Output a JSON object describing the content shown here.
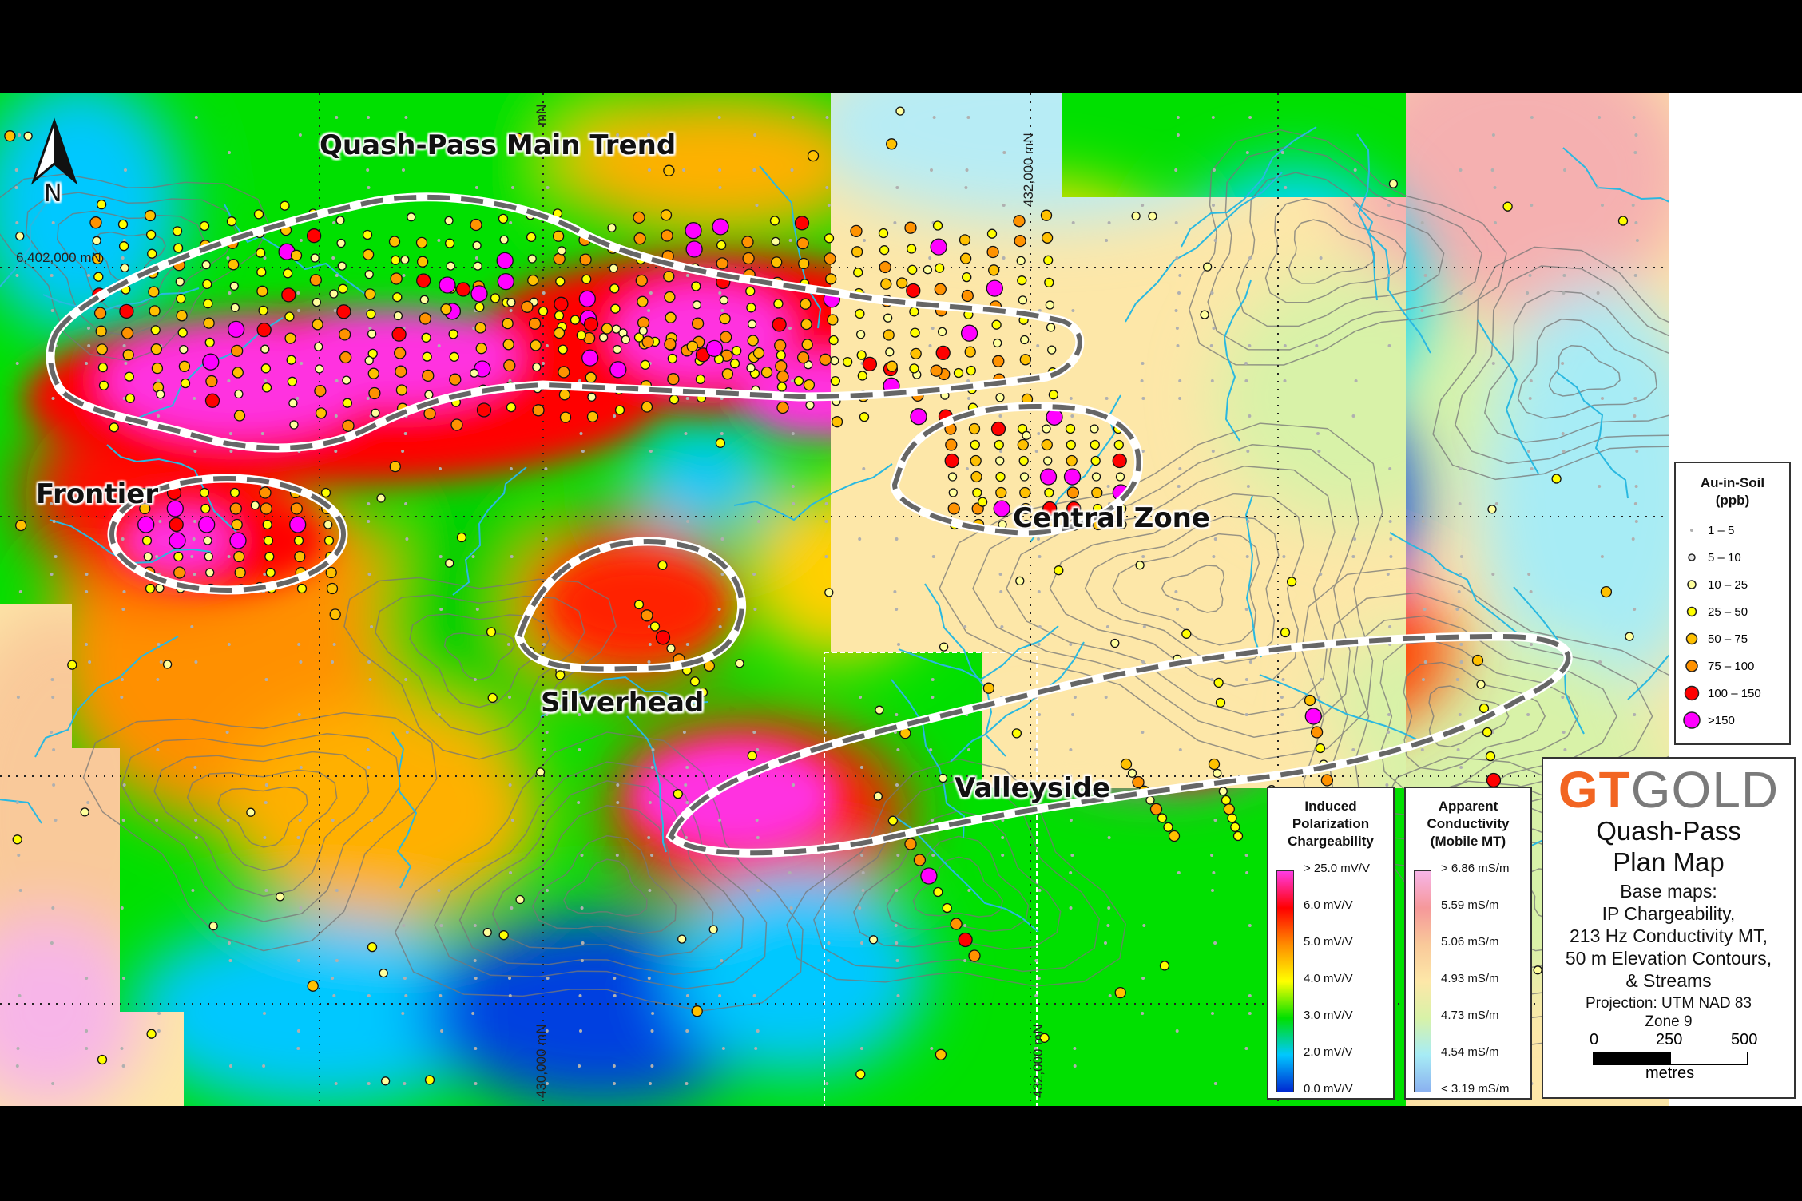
{
  "north_arrow": {
    "label": "N"
  },
  "zones": {
    "quash_pass": "Quash-Pass Main Trend",
    "frontier": "Frontier",
    "central": "Central Zone",
    "silverhead": "Silverhead",
    "valleyside": "Valleyside"
  },
  "coordinates": {
    "northing": "6,402,000 mN",
    "e430_top": "mN",
    "e432_top": "432,000 mN",
    "e430_bottom": "430,000 mN",
    "e432_bottom": "432,000 mN"
  },
  "legend_ip": {
    "title_lines": [
      "Induced",
      "Polarization",
      "Chargeability"
    ],
    "labels": [
      "> 25.0 mV/V",
      "6.0 mV/V",
      "5.0 mV/V",
      "4.0 mV/V",
      "3.0 mV/V",
      "2.0 mV/V",
      "0.0 mV/V"
    ],
    "colors": [
      "#ff3ce6",
      "#ff0000",
      "#ff8c00",
      "#ffff00",
      "#00e000",
      "#00c8ff",
      "#0028d2"
    ]
  },
  "legend_mt": {
    "title_lines": [
      "Apparent",
      "Conductivity",
      "(Mobile MT)"
    ],
    "labels": [
      "> 6.86 mS/m",
      "5.59 mS/m",
      "5.06 mS/m",
      "4.93 mS/m",
      "4.73 mS/m",
      "4.54 mS/m",
      "< 3.19 mS/m"
    ],
    "colors": [
      "#f7b5e8",
      "#f5989a",
      "#f9c99a",
      "#fde7a8",
      "#d8f2a8",
      "#a7ecf5",
      "#8ab1f0"
    ]
  },
  "legend_au": {
    "title_lines": [
      "Au-in-Soil",
      "(ppb)"
    ],
    "items": [
      {
        "label": "1 – 5",
        "color": "#b0b0b0"
      },
      {
        "label": "5 – 10",
        "color": "#e4e4e4"
      },
      {
        "label": "10 – 25",
        "color": "#ffff9c"
      },
      {
        "label": "25 – 50",
        "color": "#ffff00"
      },
      {
        "label": "50 – 75",
        "color": "#ffc000"
      },
      {
        "label": "75 – 100",
        "color": "#ff9200"
      },
      {
        "label": "100 – 150",
        "color": "#ff0000"
      },
      {
        "label": ">150",
        "color": "#ff00ff"
      }
    ]
  },
  "title_block": {
    "logo_gt": "GT",
    "logo_gold": "GOLD",
    "logo_color": "#f26522",
    "lines": [
      "Quash-Pass",
      "Plan Map",
      "Base maps:",
      "IP Chargeability,",
      "213 Hz Conductivity MT,",
      "50 m Elevation Contours,",
      "& Streams",
      "Projection: UTM NAD 83",
      "Zone 9"
    ],
    "scale_labels": [
      "0",
      "250",
      "500"
    ],
    "scale_unit": "metres"
  }
}
